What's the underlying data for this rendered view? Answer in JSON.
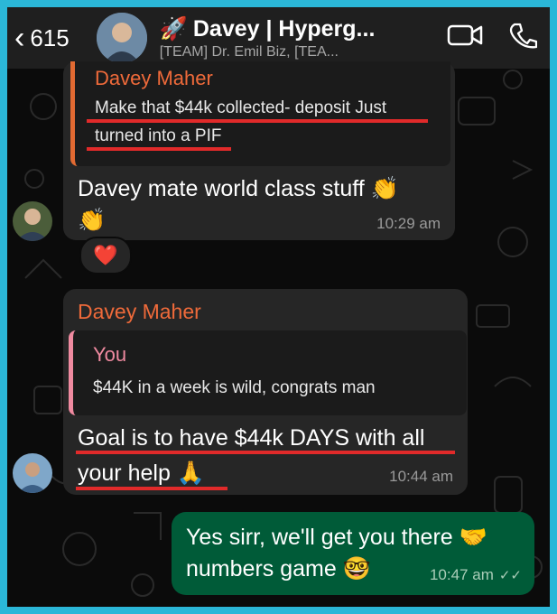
{
  "header": {
    "back_count": "615",
    "title": "Davey | Hyperg...",
    "subtitle": "[TEAM] Dr. Emil Biz, [TEA..."
  },
  "messages": {
    "first": {
      "quoted_name": "Davey Maher",
      "quoted_line1": "Make that $44k collected- deposit Just",
      "quoted_line2": "turned into a PIF",
      "text_line1": "Davey mate world class stuff 👏",
      "text_line2": "👏",
      "time": "10:29 am",
      "reaction": "❤️"
    },
    "second": {
      "sender": "Davey Maher",
      "quoted_name": "You",
      "quoted_text": "$44K in a week is wild, congrats man",
      "text_line1": "Goal is to have $44k DAYS with all",
      "text_line2": "your help 🙏",
      "time": "10:44 am"
    },
    "outgoing": {
      "text_line1": "Yes sirr, we'll get you there 🤝",
      "text_line2": "numbers game 🤓",
      "time": "10:47 am",
      "read_ticks": "✓✓"
    }
  },
  "colors": {
    "accent_orange": "#ef6a3a",
    "you_pink": "#f08aa0",
    "underline_red": "#e12a2a",
    "outgoing_green": "#005b38",
    "frame_cyan": "#2bb7d8"
  }
}
